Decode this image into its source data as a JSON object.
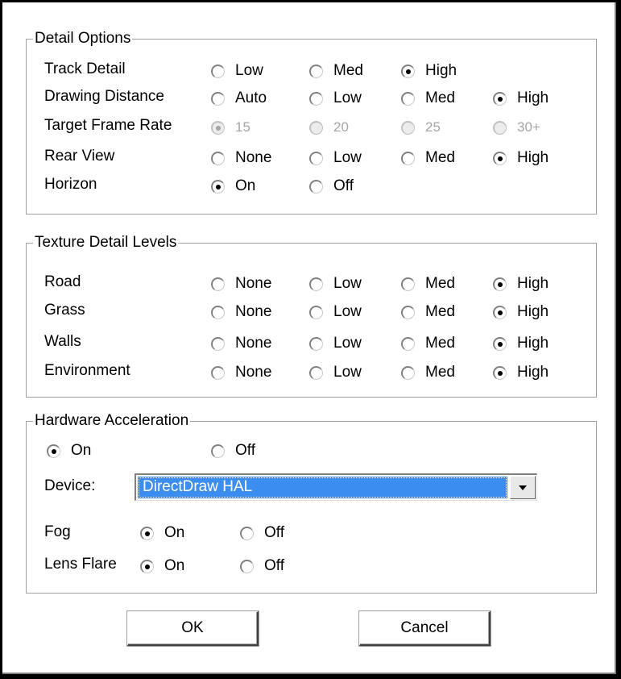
{
  "detail_options": {
    "title": "Detail Options",
    "rows": [
      {
        "label": "Track Detail",
        "options": [
          "Low",
          "Med",
          "High"
        ],
        "selected": 2
      },
      {
        "label": "Drawing Distance",
        "options": [
          "Auto",
          "Low",
          "Med",
          "High"
        ],
        "selected": 3
      },
      {
        "label": "Target Frame Rate",
        "options": [
          "15",
          "20",
          "25",
          "30+"
        ],
        "selected": 0,
        "disabled": true
      },
      {
        "label": "Rear View",
        "options": [
          "None",
          "Low",
          "Med",
          "High"
        ],
        "selected": 3
      },
      {
        "label": "Horizon",
        "options": [
          "On",
          "Off"
        ],
        "selected": 0
      }
    ]
  },
  "texture_detail": {
    "title": "Texture Detail Levels",
    "rows": [
      {
        "label": "Road",
        "options": [
          "None",
          "Low",
          "Med",
          "High"
        ],
        "selected": 3
      },
      {
        "label": "Grass",
        "options": [
          "None",
          "Low",
          "Med",
          "High"
        ],
        "selected": 3
      },
      {
        "label": "Walls",
        "options": [
          "None",
          "Low",
          "Med",
          "High"
        ],
        "selected": 3
      },
      {
        "label": "Environment",
        "options": [
          "None",
          "Low",
          "Med",
          "High"
        ],
        "selected": 3
      }
    ]
  },
  "hardware": {
    "title": "Hardware Acceleration",
    "accel": {
      "options": [
        "On",
        "Off"
      ],
      "selected": 0
    },
    "device_label": "Device:",
    "device_value": "DirectDraw HAL",
    "fog": {
      "label": "Fog",
      "options": [
        "On",
        "Off"
      ],
      "selected": 0
    },
    "lens_flare": {
      "label": "Lens Flare",
      "options": [
        "On",
        "Off"
      ],
      "selected": 0
    }
  },
  "buttons": {
    "ok": "OK",
    "cancel": "Cancel"
  },
  "colors": {
    "selection": "#3b8ef0",
    "disabled_text": "#a5a5a5"
  }
}
